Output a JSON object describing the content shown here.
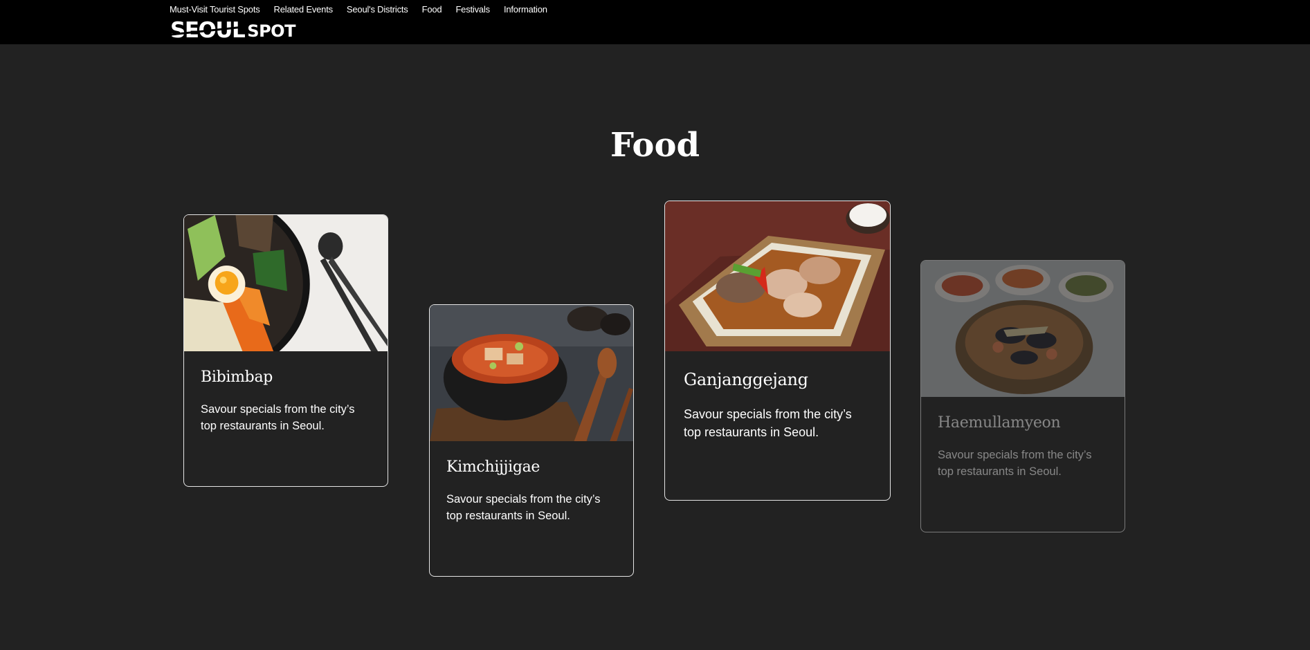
{
  "nav": {
    "items": [
      {
        "label": "Must-Visit Tourist Spots"
      },
      {
        "label": "Related Events"
      },
      {
        "label": "Seoul's Districts"
      },
      {
        "label": "Food"
      },
      {
        "label": "Festivals"
      },
      {
        "label": "Information"
      }
    ]
  },
  "logo": {
    "primary": "SEOUL",
    "secondary": "SPOT"
  },
  "page": {
    "title": "Food"
  },
  "cards": [
    {
      "title": "Bibimbap",
      "description": "Savour specials from the city’s top restaurants in Seoul.",
      "image_icon": "bibimbap-photo"
    },
    {
      "title": "Kimchijjigae",
      "description": "Savour specials from the city’s top restaurants in Seoul.",
      "image_icon": "kimchi-stew-photo"
    },
    {
      "title": "Ganjanggejang",
      "description": "Savour specials from the city’s top restaurants in Seoul.",
      "image_icon": "soy-crab-photo"
    },
    {
      "title": "Haemullamyeon",
      "description": "Savour specials from the city’s top restaurants in Seoul.",
      "image_icon": "seafood-ramen-photo"
    }
  ],
  "colors": {
    "header_bg": "#000000",
    "page_bg": "#222222",
    "card_border": "#e6e6e6",
    "text": "#ffffff"
  }
}
